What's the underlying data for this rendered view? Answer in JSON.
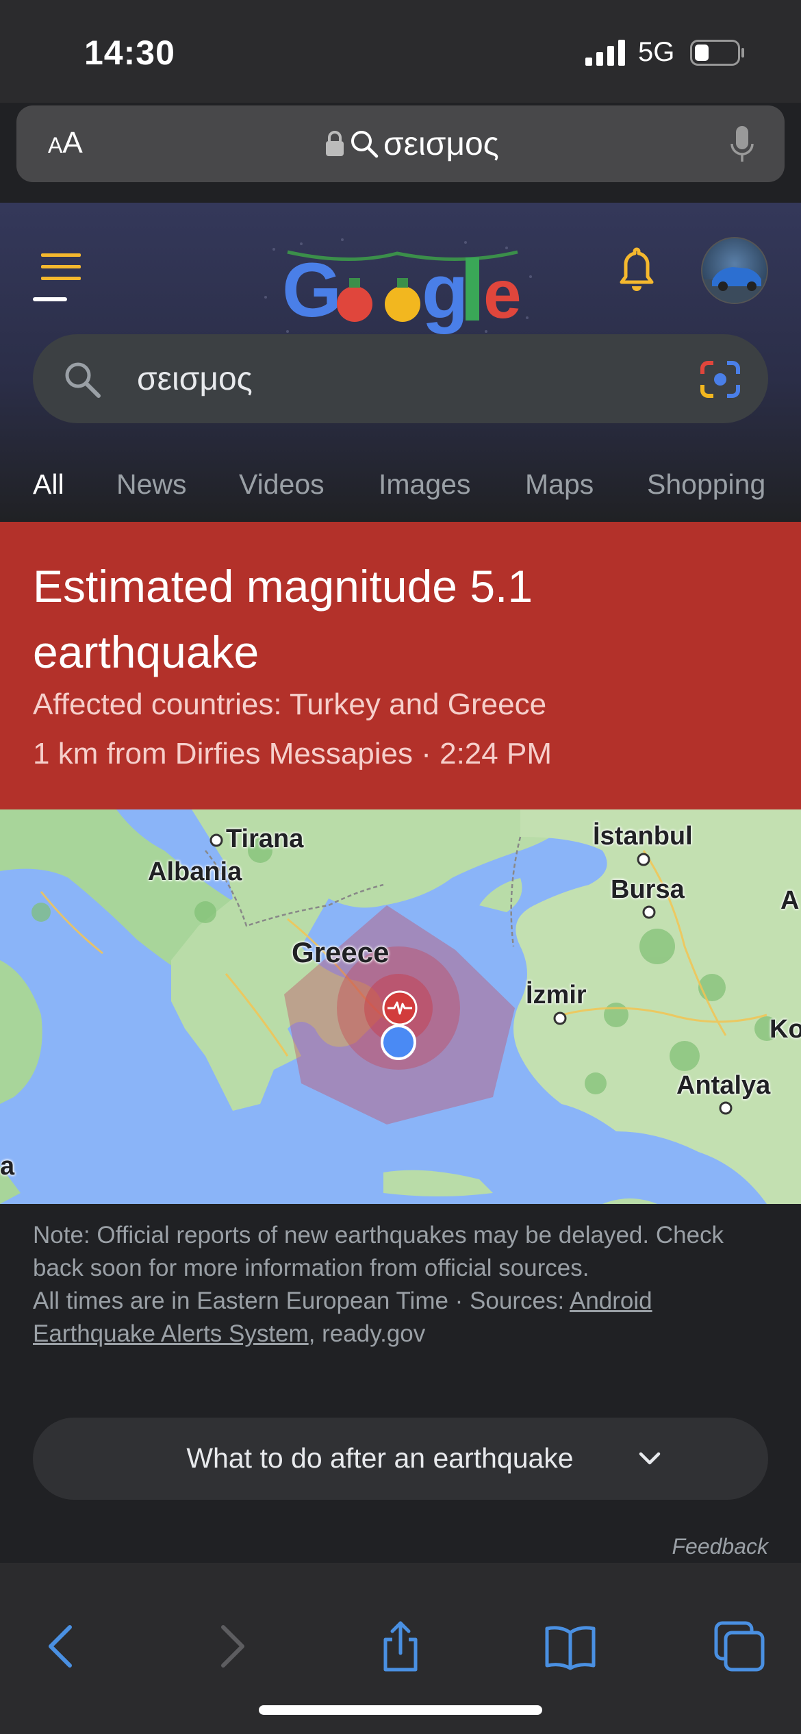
{
  "status_bar": {
    "time": "14:30",
    "network": "5G"
  },
  "address_bar": {
    "aa_small": "A",
    "aa_large": "A",
    "query": "σεισμος"
  },
  "search": {
    "query": "σεισμος"
  },
  "tabs": [
    {
      "label": "All",
      "active": true
    },
    {
      "label": "News"
    },
    {
      "label": "Videos"
    },
    {
      "label": "Images"
    },
    {
      "label": "Maps"
    },
    {
      "label": "Shopping"
    }
  ],
  "alert": {
    "title": "Estimated magnitude 5.1 earthquake",
    "countries": "Affected countries: Turkey and Greece",
    "location": "1 km from Dirfies Messapies · 2:24 PM",
    "color": "#b3312a"
  },
  "map": {
    "labels": {
      "tirana": "Tirana",
      "albania": "Albania",
      "istanbul": "İstanbul",
      "bursa": "Bursa",
      "a_edge": "A",
      "greece": "Greece",
      "izmir": "İzmir",
      "ko_edge": "Ko",
      "antalya": "Antalya",
      "a_left": "a"
    }
  },
  "note": {
    "line1": "Note: Official reports of new earthquakes may be delayed. Check back soon for more information from official sources.",
    "line2_prefix": "All times are in Eastern European Time · Sources: ",
    "source1": "Android Earthquake Alerts System",
    "separator": ", ",
    "source2": "ready.gov"
  },
  "expand": {
    "label": "What to do after an earthquake"
  },
  "feedback": "Feedback",
  "icons": {
    "menu": "hamburger-menu-icon",
    "bell": "bell-icon",
    "search": "search-icon",
    "lens": "google-lens-icon",
    "back": "chevron-left-icon",
    "forward": "chevron-right-icon",
    "share": "share-icon",
    "bookmarks": "book-icon",
    "tabs": "tabs-icon"
  },
  "colors": {
    "accent_blue": "#4a90e2",
    "menu_gold": "#f5b82e"
  }
}
